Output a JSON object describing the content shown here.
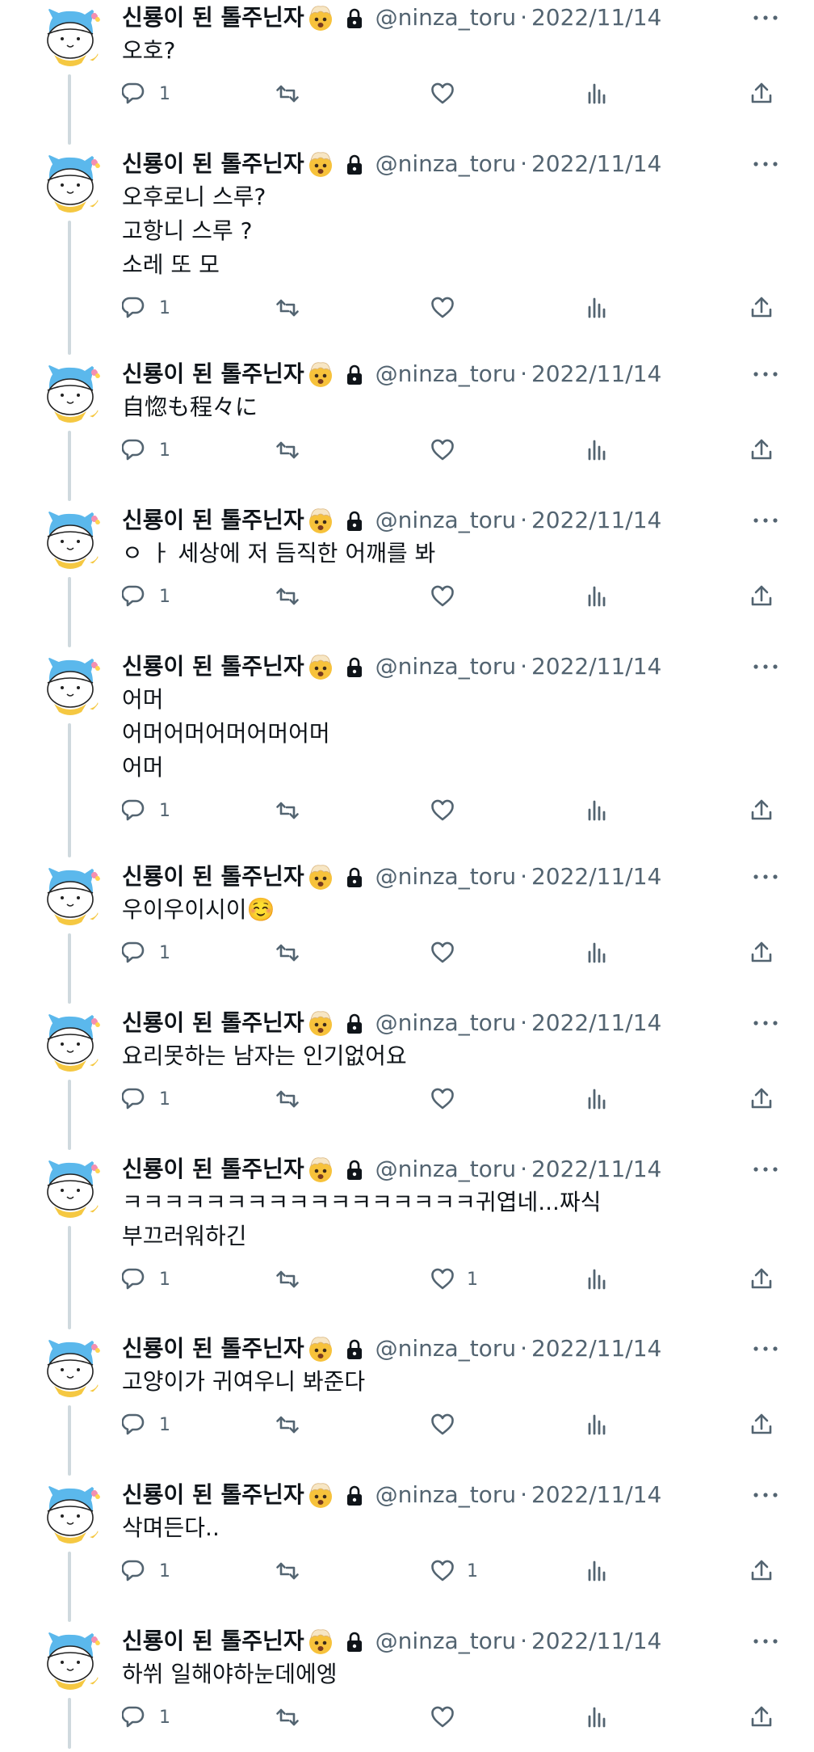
{
  "author": {
    "display_name": "신룡이 된 톨주닌자",
    "handle": "@ninza_toru",
    "verified_emoji": "exploding-head-face",
    "protected_icon": "lock-icon"
  },
  "separator": "·",
  "tweets": [
    {
      "date": "2022/11/14",
      "lines": [
        "오호?"
      ],
      "replies": "1",
      "retweets": "",
      "likes": "",
      "views": ""
    },
    {
      "date": "2022/11/14",
      "lines": [
        "오후로니 스루?",
        "고항니 스루 ?",
        "소레 또 모"
      ],
      "replies": "1",
      "retweets": "",
      "likes": "",
      "views": ""
    },
    {
      "date": "2022/11/14",
      "lines": [
        "自惚も程々に"
      ],
      "replies": "1",
      "retweets": "",
      "likes": "",
      "views": ""
    },
    {
      "date": "2022/11/14",
      "lines": [
        "ㅇ ㅏ 세상에 저 듬직한 어깨를 봐"
      ],
      "replies": "1",
      "retweets": "",
      "likes": "",
      "views": ""
    },
    {
      "date": "2022/11/14",
      "lines": [
        "어머",
        "어머어머어머어머어머",
        "어머"
      ],
      "replies": "1",
      "retweets": "",
      "likes": "",
      "views": ""
    },
    {
      "date": "2022/11/14",
      "lines": [
        "우이우이시이☺️"
      ],
      "replies": "1",
      "retweets": "",
      "likes": "",
      "views": ""
    },
    {
      "date": "2022/11/14",
      "lines": [
        "요리못하는 남자는 인기없어요"
      ],
      "replies": "1",
      "retweets": "",
      "likes": "",
      "views": ""
    },
    {
      "date": "2022/11/14",
      "lines": [
        "ㅋㅋㅋㅋㅋㅋㅋㅋㅋㅋㅋㅋㅋㅋㅋㅋㅋ귀엽네...짜식",
        "부끄러워하긴"
      ],
      "replies": "1",
      "retweets": "",
      "likes": "1",
      "views": ""
    },
    {
      "date": "2022/11/14",
      "lines": [
        "고양이가 귀여우니 봐준다"
      ],
      "replies": "1",
      "retweets": "",
      "likes": "",
      "views": ""
    },
    {
      "date": "2022/11/14",
      "lines": [
        "삭며든다.."
      ],
      "replies": "1",
      "retweets": "",
      "likes": "1",
      "views": ""
    },
    {
      "date": "2022/11/14",
      "lines": [
        "하쒸 일해야하눈데에엥"
      ],
      "replies": "1",
      "retweets": "",
      "likes": "",
      "views": ""
    }
  ],
  "icons": {
    "reply": "reply-icon",
    "retweet": "retweet-icon",
    "like": "heart-icon",
    "views": "views-icon",
    "share": "share-icon",
    "more": "more-icon"
  },
  "colors": {
    "text": "#0f1419",
    "secondary": "#536471",
    "thread_line": "#cfd9de",
    "avatar_blue": "#5bb8ec",
    "avatar_yellow": "#f5c842"
  }
}
